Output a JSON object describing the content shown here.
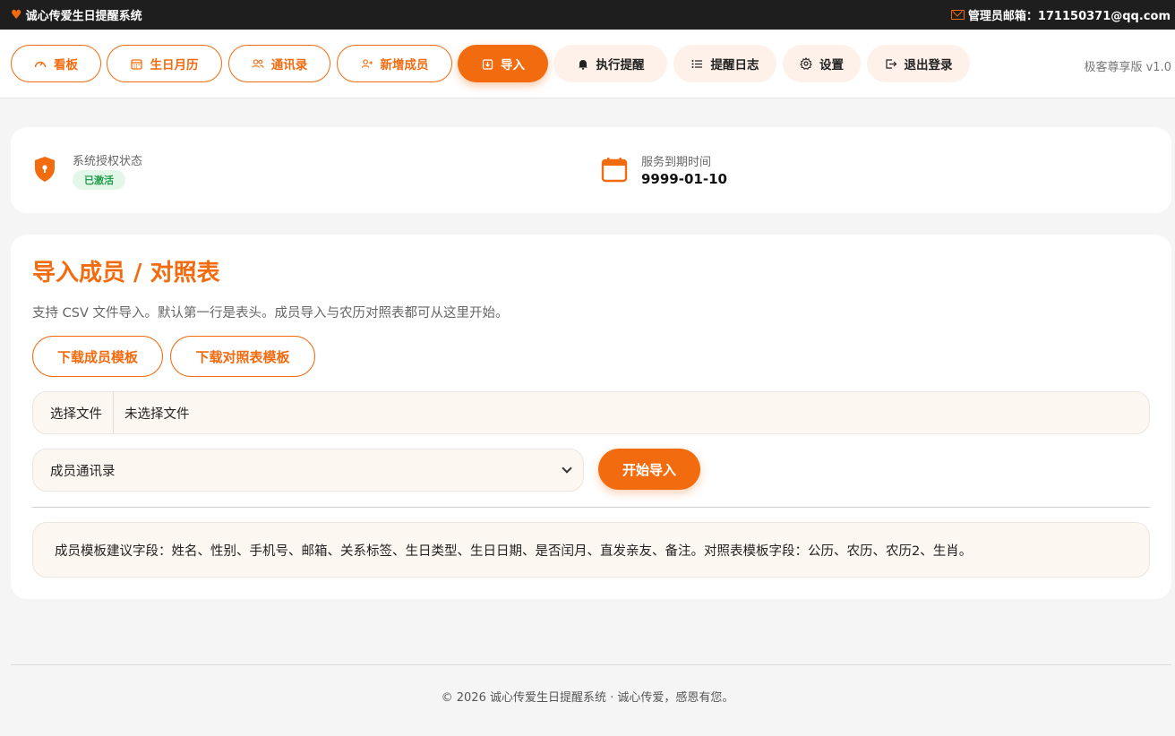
{
  "topbar": {
    "app_name": "诚心传爱生日提醒系统",
    "admin_label": "管理员邮箱：171150371@qq.com"
  },
  "nav": {
    "items": [
      {
        "label": "看板",
        "icon": "dashboard-gauge-icon",
        "style": "outline"
      },
      {
        "label": "生日月历",
        "icon": "calendar-icon",
        "style": "outline"
      },
      {
        "label": "通讯录",
        "icon": "users-icon",
        "style": "outline"
      },
      {
        "label": "新增成员",
        "icon": "user-plus-icon",
        "style": "outline"
      },
      {
        "label": "导入",
        "icon": "download-tray-icon",
        "style": "active"
      },
      {
        "label": "执行提醒",
        "icon": "bell-icon",
        "style": "soft"
      },
      {
        "label": "提醒日志",
        "icon": "list-icon",
        "style": "soft"
      },
      {
        "label": "设置",
        "icon": "gear-icon",
        "style": "soft"
      },
      {
        "label": "退出登录",
        "icon": "logout-icon",
        "style": "soft"
      }
    ],
    "version": "极客尊享版 v1.0"
  },
  "status": {
    "license_label": "系统授权状态",
    "license_badge": "已激活",
    "expire_label": "服务到期时间",
    "expire_value": "9999-01-10"
  },
  "import": {
    "title": "导入成员 / 对照表",
    "description": "支持 CSV 文件导入。默认第一行是表头。成员导入与农历对照表都可从这里开始。",
    "download_member_template": "下载成员模板",
    "download_mapping_template": "下载对照表模板",
    "file_button": "选择文件",
    "file_status": "未选择文件",
    "select_value": "成员通讯录",
    "start_button": "开始导入",
    "hint": "成员模板建议字段：姓名、性别、手机号、邮箱、关系标签、生日类型、生日日期、是否闰月、直发亲友、备注。对照表模板字段：公历、农历、农历2、生肖。"
  },
  "footer": {
    "text": "© 2026 诚心传爱生日提醒系统 · 诚心传爱，感恩有您。"
  },
  "colors": {
    "accent": "#f26b0f",
    "topbar_bg": "#1e1e1e",
    "badge_bg": "#e3f7e9",
    "badge_text": "#1f9c4b",
    "soft_bg": "#fdf1e9"
  }
}
